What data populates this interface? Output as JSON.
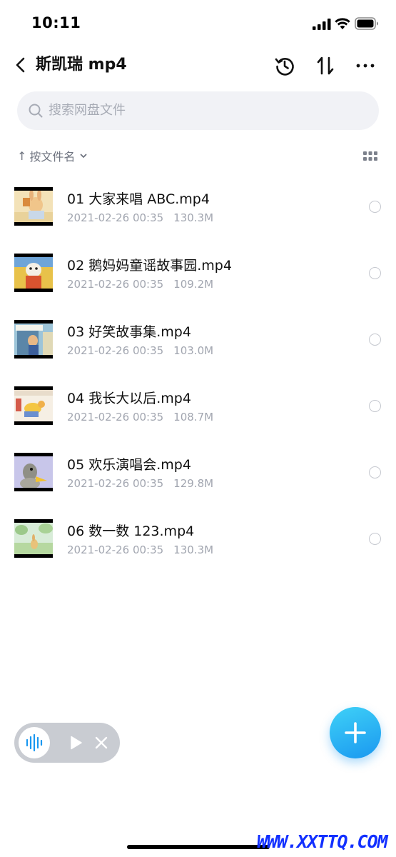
{
  "status_bar": {
    "time": "10:11"
  },
  "nav": {
    "title": "斯凯瑞 mp4"
  },
  "search": {
    "placeholder": "搜索网盘文件"
  },
  "sort": {
    "arrow": "↑",
    "label": "按文件名"
  },
  "files": [
    {
      "name": "01 大家来唱 ABC.mp4",
      "date": "2021-02-26 00:35",
      "size": "130.3M"
    },
    {
      "name": "02 鹅妈妈童谣故事园.mp4",
      "date": "2021-02-26 00:35",
      "size": "109.2M"
    },
    {
      "name": "03 好笑故事集.mp4",
      "date": "2021-02-26 00:35",
      "size": "103.0M"
    },
    {
      "name": "04 我长大以后.mp4",
      "date": "2021-02-26 00:35",
      "size": "108.7M"
    },
    {
      "name": "05 欢乐演唱会.mp4",
      "date": "2021-02-26 00:35",
      "size": "129.8M"
    },
    {
      "name": "06 数一数 123.mp4",
      "date": "2021-02-26 00:35",
      "size": "130.3M"
    }
  ],
  "watermark": "WWW.XXTTQ.COM",
  "colors": {
    "accent": "#1a98f0",
    "fab_light": "#3fd1f7",
    "meta_text": "#a2a6b0",
    "watermark": "#1230ff"
  },
  "icons": [
    "back-icon",
    "history-icon",
    "sort-icon",
    "more-icon",
    "search-icon",
    "chevron-down-icon",
    "grid-view-icon",
    "audio-wave-icon",
    "play-icon",
    "close-icon",
    "plus-icon"
  ]
}
